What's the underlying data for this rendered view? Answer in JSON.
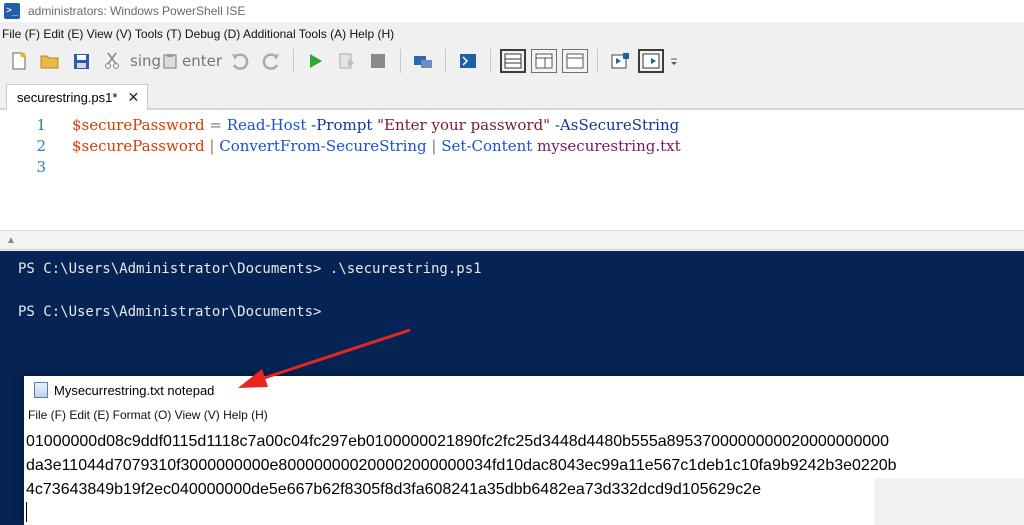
{
  "window": {
    "title": "administrators: Windows PowerShell ISE",
    "app_icon": "powershell-icon"
  },
  "menu": "File (F) Edit (E) View (V) Tools (T) Debug (D) Additional Tools (A) Help (H)",
  "toolbar": {
    "sing_label": "sing",
    "enter_label": "enter"
  },
  "tab": {
    "label": "securestring.ps1*"
  },
  "editor": {
    "lines": [
      {
        "num": "1",
        "var": "$securePassword",
        "op1": " = ",
        "cmd": "Read-Host",
        "param1": " -Prompt",
        "str": " \"Enter your password\"",
        "param2": " -AsSecureString"
      },
      {
        "num": "2",
        "var": "$securePassword",
        "op1": " | ",
        "cmd": "ConvertFrom-SecureString",
        "op2": " | ",
        "cmd2": "Set-Content",
        "arg": " mysecurestring.txt"
      },
      {
        "num": "3"
      }
    ]
  },
  "console": {
    "line1": "PS C:\\Users\\Administrator\\Documents> .\\securestring.ps1",
    "line2": "PS C:\\Users\\Administrator\\Documents>"
  },
  "notepad": {
    "title": "Mysecurrestring.txt notepad",
    "menu": "File (F) Edit (E) Format (O) View (V) Help (H)",
    "content_lines": [
      "01000000d08c9ddf0115d1118c7a00c04fc297eb0100000021890fc2fc25d3448d4480b555a8953700000000020000000000",
      "da3e11044d7079310f3000000000e800000000200002000000034fd10dac8043ec99a11e567c1deb1c10fa9b9242b3e0220b",
      "4c73643849b19f2ec040000000de5e667b62f8305f8d3fa608241a35dbb6482ea73d332dcd9d105629c2e"
    ]
  },
  "colors": {
    "console_bg": "#052455",
    "variable": "#d83b01",
    "cmdlet": "#1a4fd6",
    "string": "#7a1a3a",
    "line_number": "#2b7bb2",
    "annotation_arrow": "#e8261e"
  }
}
